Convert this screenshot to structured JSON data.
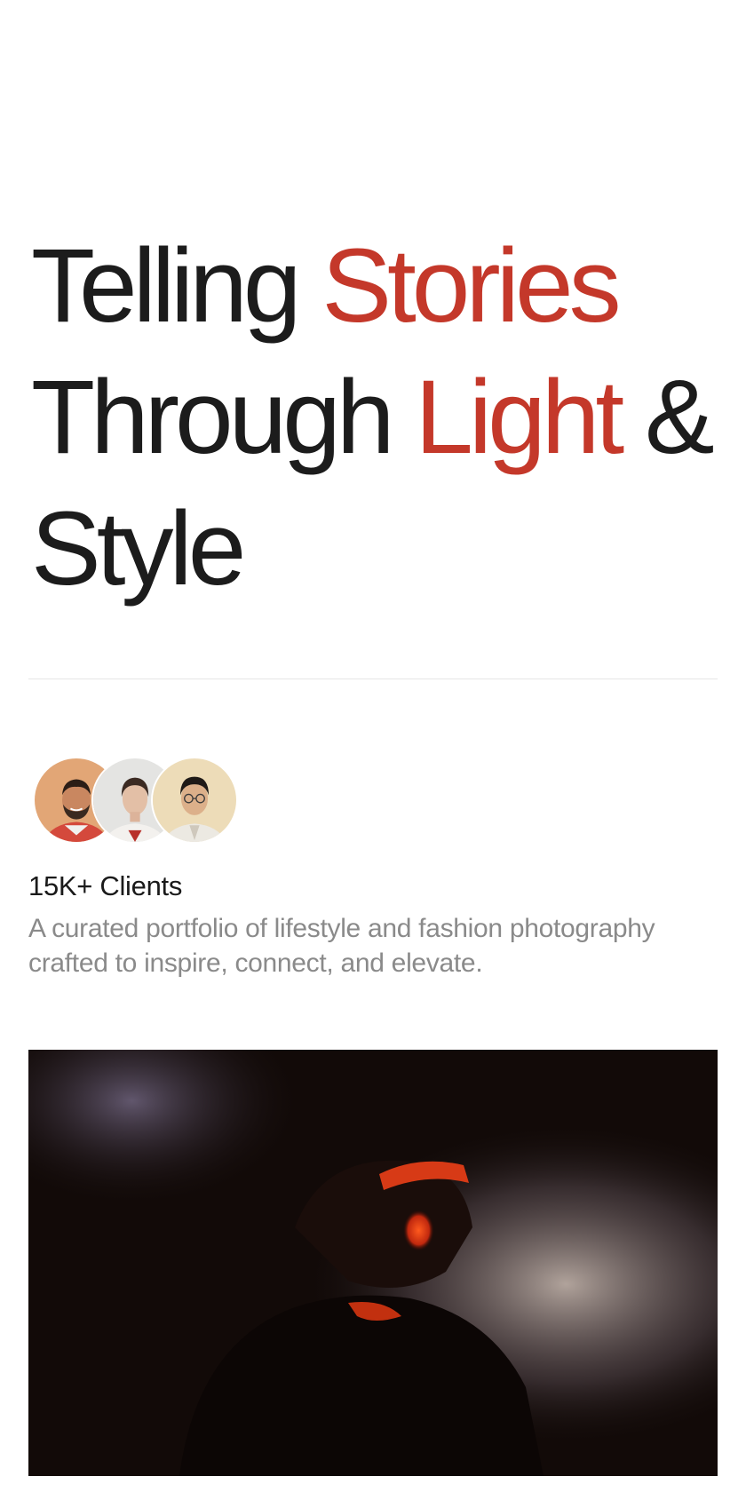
{
  "hero": {
    "line1_plain": "Telling ",
    "line1_accent": "Stories",
    "line2_plain": "Through ",
    "line2_accent": "Light",
    "line2_rest": " &",
    "line3_plain": "Style"
  },
  "stats": {
    "clients_label": "15K+ Clients",
    "description": "A curated portfolio of lifestyle and fashion photography crafted to inspire, connect, and elevate."
  },
  "colors": {
    "accent": "#c4382a",
    "text": "#1c1c1c",
    "muted": "#8a8a8a"
  },
  "avatars": [
    {
      "icon": "avatar-man-beard-photo"
    },
    {
      "icon": "avatar-woman-photo"
    },
    {
      "icon": "avatar-man-glasses-photo"
    }
  ],
  "featured_image": {
    "icon": "portrait-red-light-photo"
  }
}
